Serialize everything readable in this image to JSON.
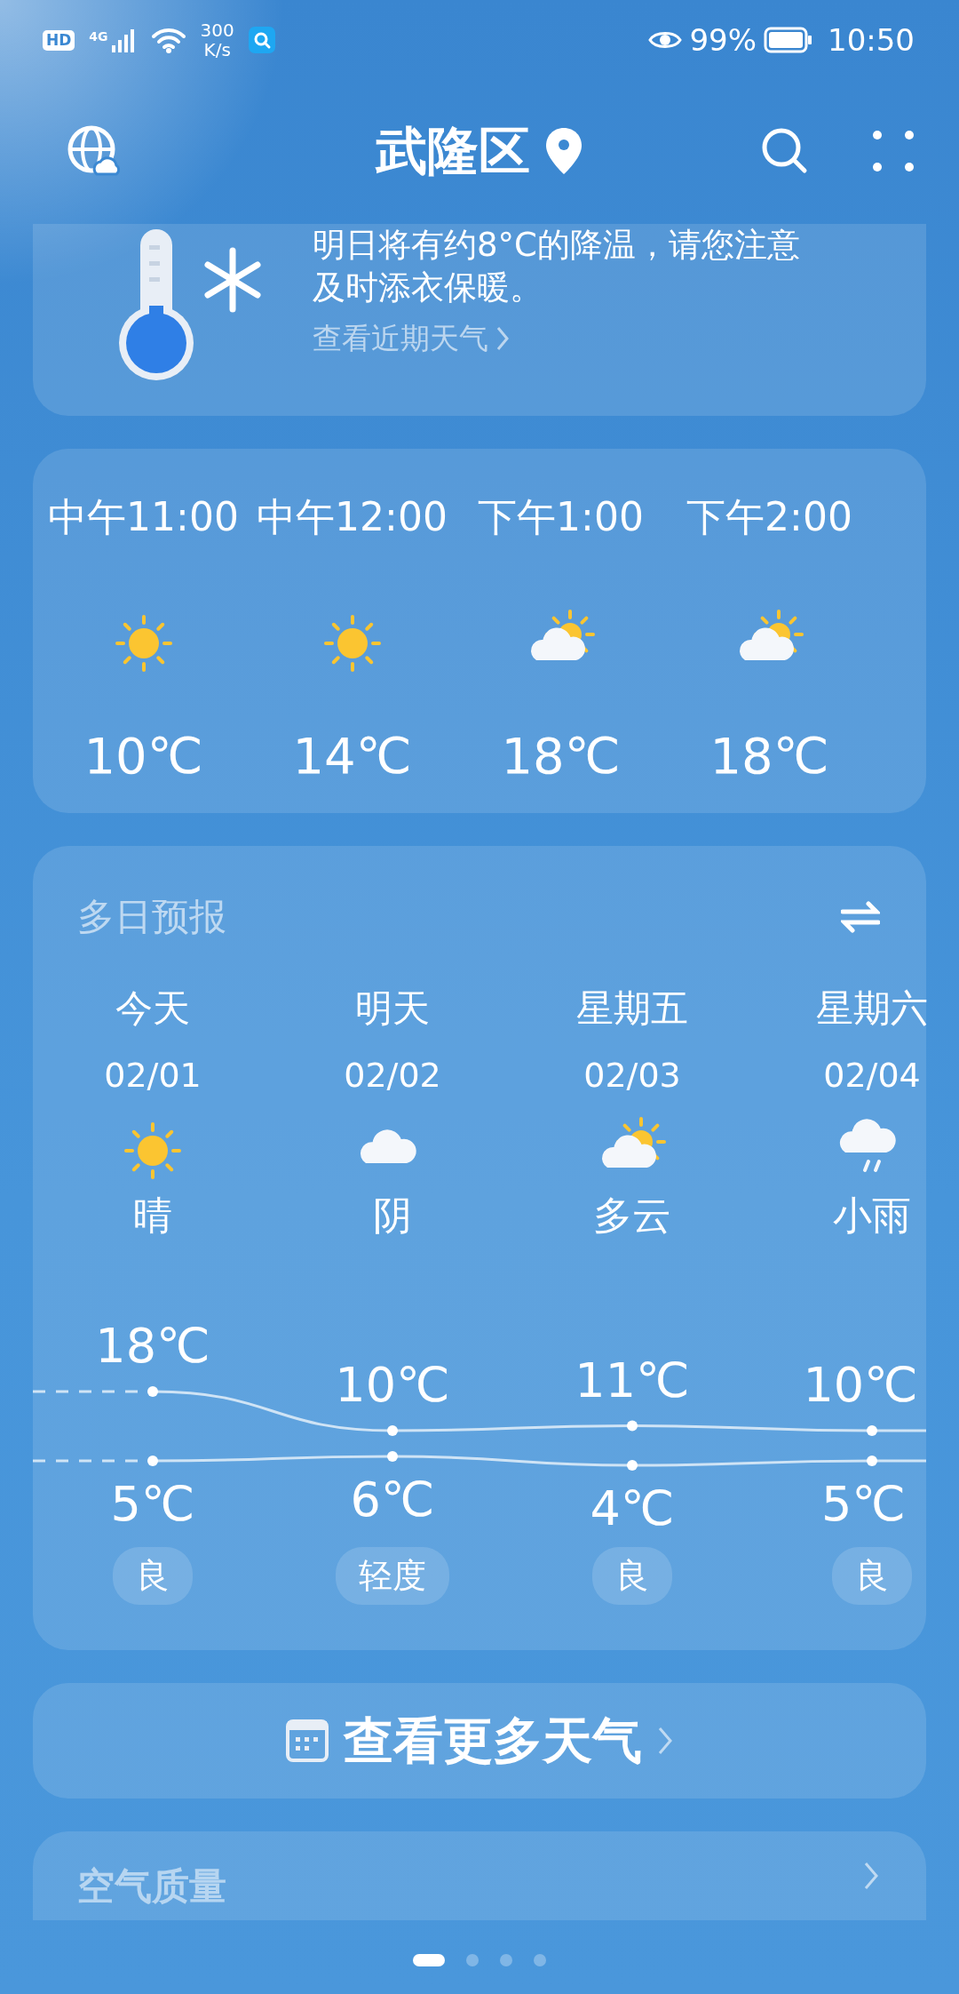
{
  "status_bar": {
    "hd": "HD",
    "network": "4G",
    "speed": "300",
    "speed_unit": "K/s",
    "battery": "99%",
    "time": "10:50"
  },
  "header": {
    "title": "武隆区"
  },
  "alert": {
    "message": "明日将有约8°C的降温，请您注意及时添衣保暖。",
    "link": "查看近期天气"
  },
  "hourly": [
    {
      "time": "中午11:00",
      "kind": "sunny",
      "temp": "10℃"
    },
    {
      "time": "中午12:00",
      "kind": "sunny",
      "temp": "14℃"
    },
    {
      "time": "下午1:00",
      "kind": "partly_cloudy",
      "temp": "18℃"
    },
    {
      "time": "下午2:00",
      "kind": "partly_cloudy",
      "temp": "18℃"
    }
  ],
  "daily": {
    "title": "多日预报",
    "days": [
      {
        "day": "今天",
        "date": "02/01",
        "kind": "sunny",
        "condition": "晴",
        "high": "18℃",
        "low": "5℃",
        "aqi": "良"
      },
      {
        "day": "明天",
        "date": "02/02",
        "kind": "cloudy",
        "condition": "阴",
        "high": "10℃",
        "low": "6℃",
        "aqi": "轻度"
      },
      {
        "day": "星期五",
        "date": "02/03",
        "kind": "partly_cloudy",
        "condition": "多云",
        "high": "11℃",
        "low": "4℃",
        "aqi": "良"
      },
      {
        "day": "星期六",
        "date": "02/04",
        "kind": "light_rain",
        "condition": "小雨",
        "high": "10℃",
        "low": "5℃",
        "aqi": "良"
      }
    ]
  },
  "more_button": {
    "label": "查看更多天气"
  },
  "air_quality": {
    "title": "空气质量"
  },
  "page_indicator": [
    {
      "selected": true
    },
    {
      "selected": false
    },
    {
      "selected": false
    },
    {
      "selected": false
    }
  ]
}
